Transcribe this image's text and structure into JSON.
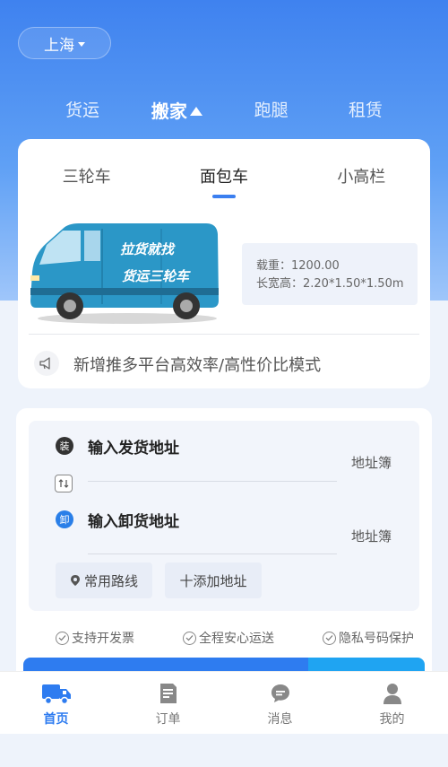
{
  "header": {
    "city": "上海",
    "tabs": [
      "货运",
      "搬家",
      "跑腿",
      "租赁"
    ],
    "active_tab": "搬家"
  },
  "vehicle_card": {
    "tabs": [
      "三轮车",
      "面包车",
      "小高栏"
    ],
    "active_tab": "面包车",
    "van_text_line1": "拉货就找",
    "van_text_line2": "货运三轮车",
    "specs": {
      "load_line": "载重：1200.00",
      "dims_line": "长宽高：2.20*1.50*1.50m"
    },
    "notice": "新增推多平台高效率/高性价比模式"
  },
  "address_card": {
    "load_badge": "装",
    "unload_badge": "卸",
    "load_title": "输入发货地址",
    "unload_title": "输入卸货地址",
    "address_book": "地址簿",
    "common_routes": "常用路线",
    "add_address": "十添加地址",
    "features": [
      "支持开发票",
      "全程安心运送",
      "隐私号码保护"
    ]
  },
  "bottom_nav": {
    "items": [
      "首页",
      "订单",
      "消息",
      "我的"
    ],
    "active": "首页"
  },
  "colors": {
    "primary": "#2e7cf0",
    "accent": "#1fa4f2",
    "header_gradient_top": "#3f82ef"
  },
  "icons": {
    "notice": "megaphone-icon",
    "swap": "swap-icon",
    "location": "location-pin-icon",
    "check": "check-circle-icon",
    "home": "truck-icon",
    "orders": "document-icon",
    "messages": "chat-icon",
    "profile": "user-icon"
  }
}
